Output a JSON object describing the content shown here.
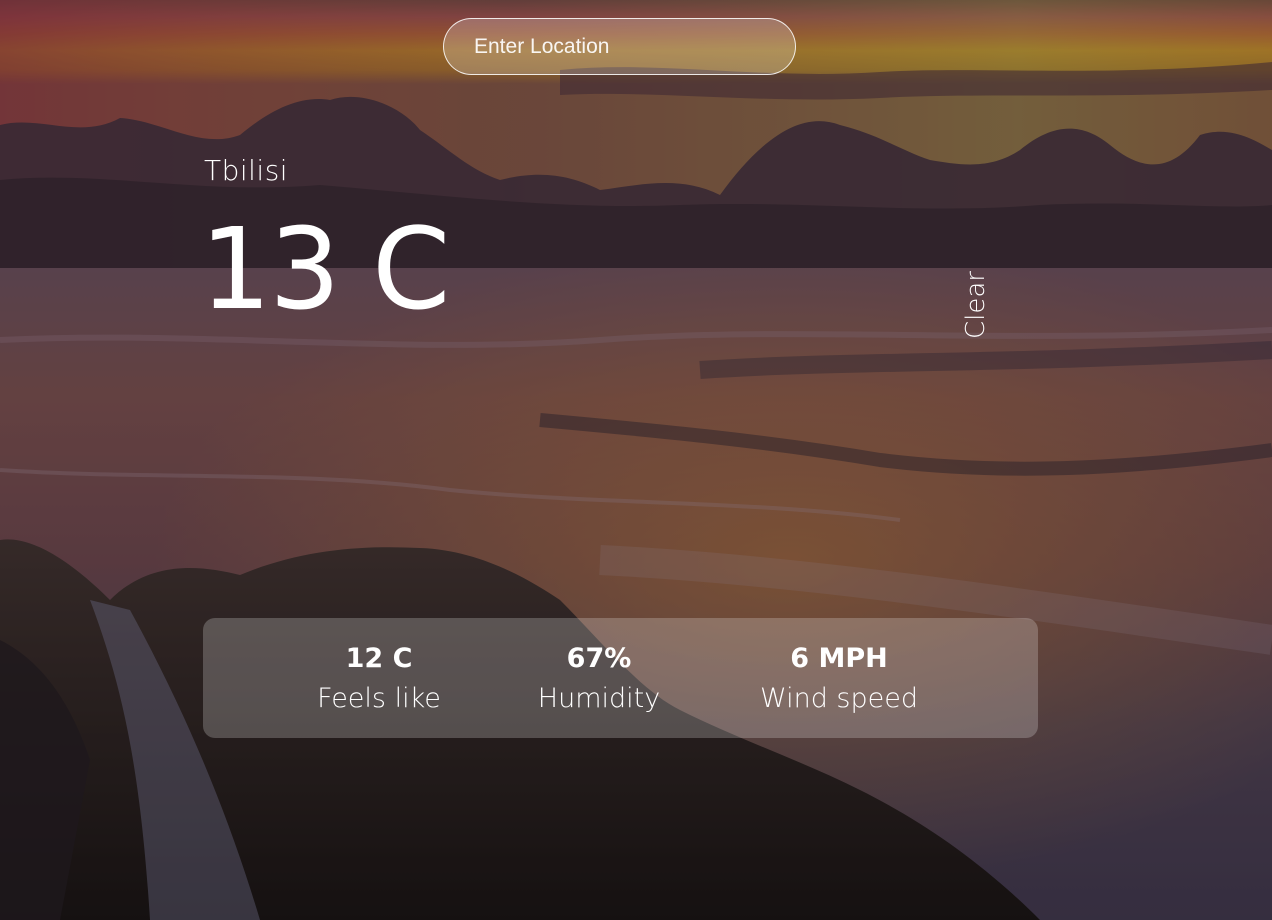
{
  "search": {
    "placeholder": "Enter Location"
  },
  "weather": {
    "city": "Tbilisi",
    "temperature": "13 C",
    "description": "Clear"
  },
  "details": [
    {
      "value": "12 C",
      "label": "Feels like"
    },
    {
      "value": "67%",
      "label": "Humidity"
    },
    {
      "value": "6 MPH",
      "label": "Wind speed"
    }
  ]
}
